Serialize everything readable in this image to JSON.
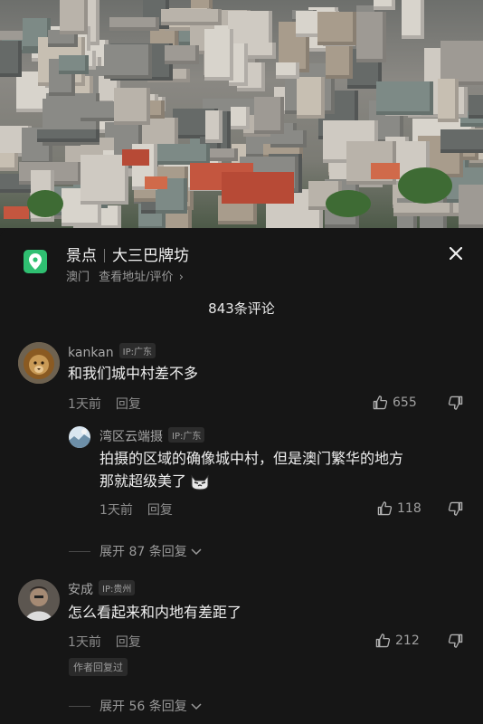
{
  "poi": {
    "category": "景点",
    "name": "大三巴牌坊",
    "city": "澳门",
    "link_text": "查看地址/评价",
    "chevron": "›",
    "icon": "location-pin-icon",
    "accent": "#2fbf71"
  },
  "comment_count": "843条评论",
  "comments": [
    {
      "user": "kankan",
      "ip": "IP:广东",
      "text": "和我们城中村差不多",
      "time": "1天前",
      "reply": "回复",
      "likes": "655"
    },
    {
      "user": "湾区云端摄",
      "ip": "IP:广东",
      "text_line1": "拍摄的区域的确像城中村，但是澳门繁华的地方",
      "text_line2": "那就超级美了",
      "emoji": "cat-emoji-icon",
      "time": "1天前",
      "reply": "回复",
      "likes": "118"
    },
    {
      "expand": "展开 87 条回复"
    },
    {
      "user": "安成",
      "ip": "IP:贵州",
      "text": "怎么看起来和内地有差距了",
      "time": "1天前",
      "reply": "回复",
      "likes": "212",
      "badge": "作者回复过"
    },
    {
      "expand": "展开 56 条回复"
    }
  ]
}
